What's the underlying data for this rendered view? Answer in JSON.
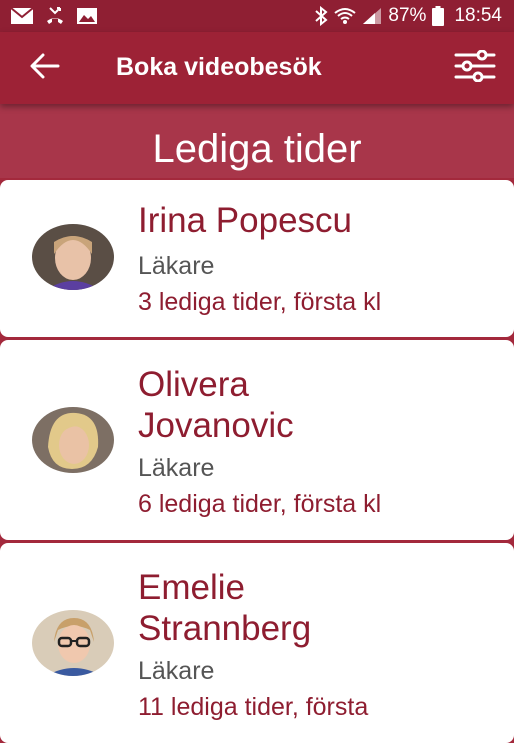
{
  "status_bar": {
    "battery": "87%",
    "time": "18:54",
    "icons": [
      "mail-icon",
      "missed-call-icon",
      "image-icon",
      "bluetooth-icon",
      "wifi-icon",
      "signal-icon",
      "battery-icon"
    ]
  },
  "app_bar": {
    "title": "Boka videobesök",
    "back_icon": "arrow-left-icon",
    "filter_icon": "sliders-icon"
  },
  "section": {
    "title": "Lediga tider"
  },
  "doctors": [
    {
      "name_lines": [
        "Irina Popescu"
      ],
      "role": "Läkare",
      "slots": "3 lediga tider, första kl"
    },
    {
      "name_lines": [
        "Olivera",
        "Jovanovic"
      ],
      "role": "Läkare",
      "slots": "6 lediga tider, första kl"
    },
    {
      "name_lines": [
        "Emelie",
        "Strannberg"
      ],
      "role": "Läkare",
      "slots": "11 lediga tider, första"
    }
  ],
  "colors": {
    "status_bar": "#8f1f33",
    "app_bar": "#9d2236",
    "section_header": "#a8364a",
    "accent_text": "#8e1d30"
  }
}
